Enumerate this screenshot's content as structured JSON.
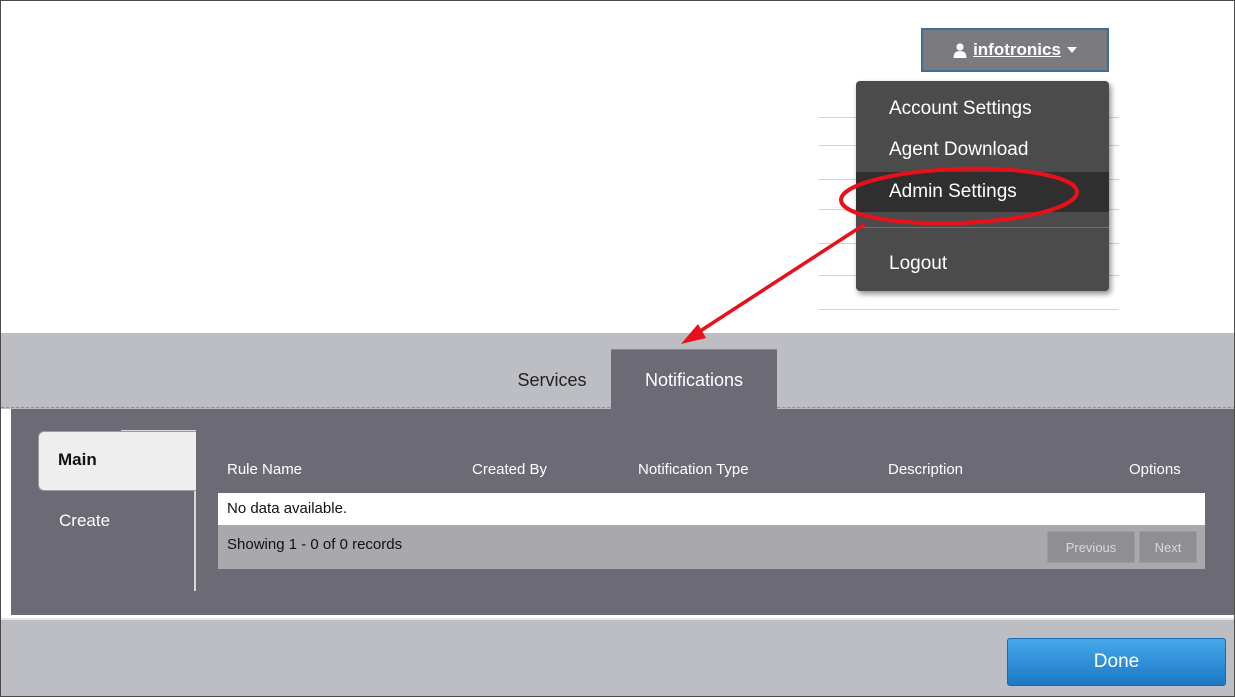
{
  "user_menu": {
    "username": "infotronics",
    "items": [
      {
        "label": "Account Settings"
      },
      {
        "label": "Agent Download"
      },
      {
        "label": "Admin Settings",
        "highlighted": true
      },
      {
        "label": "Logout"
      }
    ]
  },
  "tabs": [
    {
      "label": "Services",
      "active": false
    },
    {
      "label": "Notifications",
      "active": true
    }
  ],
  "side_nav": [
    {
      "label": "Main",
      "active": true
    },
    {
      "label": "Create",
      "active": false
    }
  ],
  "table": {
    "columns": [
      "Rule Name",
      "Created By",
      "Notification Type",
      "Description",
      "Options"
    ],
    "empty_message": "No data available.",
    "status": "Showing 1 - 0 of 0 records",
    "prev_label": "Previous",
    "next_label": "Next"
  },
  "done_label": "Done",
  "colors": {
    "annotation": "#e8101a",
    "done_button": "#1f86d9",
    "panel": "#6c6b75",
    "menu": "#4b4b4b"
  }
}
